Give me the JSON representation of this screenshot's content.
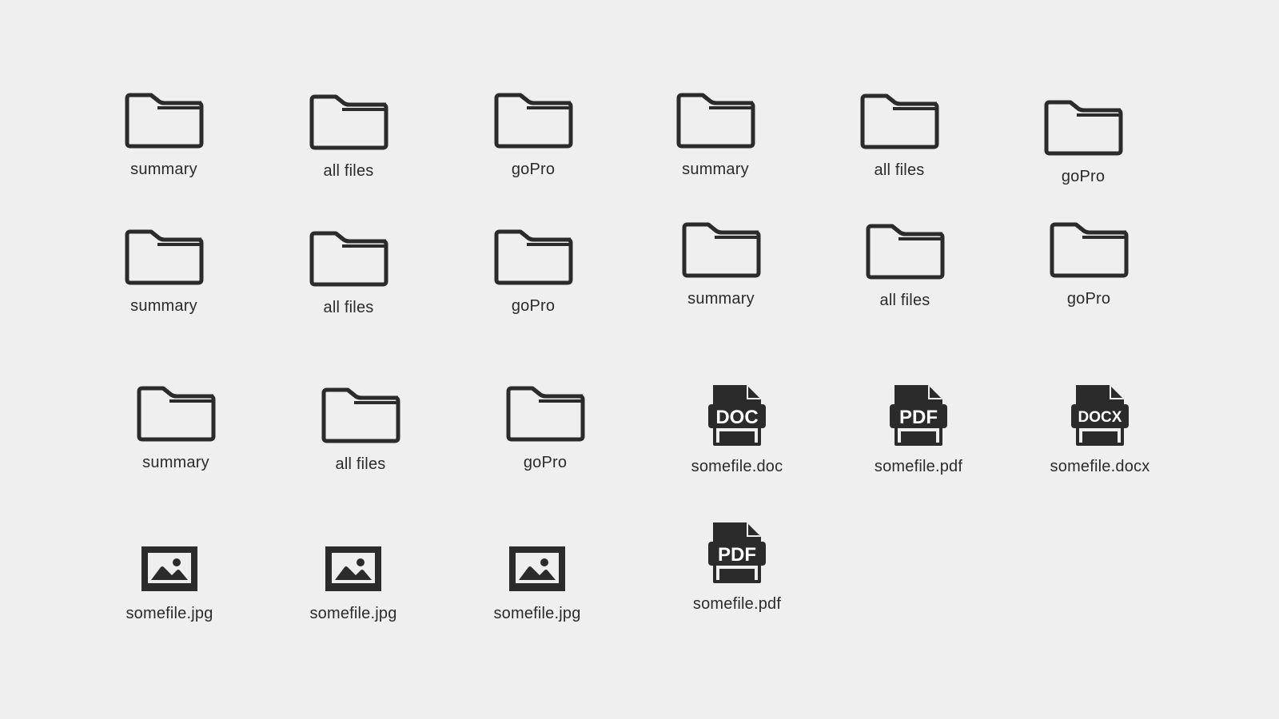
{
  "items": [
    {
      "label": "summary",
      "icon": "folder-icon",
      "type": "folder"
    },
    {
      "label": "all files",
      "icon": "folder-icon",
      "type": "folder"
    },
    {
      "label": "goPro",
      "icon": "folder-icon",
      "type": "folder"
    },
    {
      "label": "summary",
      "icon": "folder-icon",
      "type": "folder"
    },
    {
      "label": "all files",
      "icon": "folder-icon",
      "type": "folder"
    },
    {
      "label": "goPro",
      "icon": "folder-icon",
      "type": "folder"
    },
    {
      "label": "summary",
      "icon": "folder-icon",
      "type": "folder"
    },
    {
      "label": "all files",
      "icon": "folder-icon",
      "type": "folder"
    },
    {
      "label": "goPro",
      "icon": "folder-icon",
      "type": "folder"
    },
    {
      "label": "summary",
      "icon": "folder-icon",
      "type": "folder"
    },
    {
      "label": "all files",
      "icon": "folder-icon",
      "type": "folder"
    },
    {
      "label": "goPro",
      "icon": "folder-icon",
      "type": "folder"
    },
    {
      "label": "summary",
      "icon": "folder-icon",
      "type": "folder"
    },
    {
      "label": "all files",
      "icon": "folder-icon",
      "type": "folder"
    },
    {
      "label": "goPro",
      "icon": "folder-icon",
      "type": "folder"
    },
    {
      "label": "somefile.doc",
      "icon": "doc-file-icon",
      "type": "document",
      "badge": "DOC"
    },
    {
      "label": "somefile.pdf",
      "icon": "pdf-file-icon",
      "type": "document",
      "badge": "PDF"
    },
    {
      "label": "somefile.docx",
      "icon": "docx-file-icon",
      "type": "document",
      "badge": "DOCX"
    },
    {
      "label": "somefile.jpg",
      "icon": "image-file-icon",
      "type": "image"
    },
    {
      "label": "somefile.jpg",
      "icon": "image-file-icon",
      "type": "image"
    },
    {
      "label": "somefile.jpg",
      "icon": "image-file-icon",
      "type": "image"
    },
    {
      "label": "somefile.pdf",
      "icon": "pdf-file-icon",
      "type": "document",
      "badge": "PDF"
    }
  ],
  "colors": {
    "background": "#efefef",
    "icon": "#2b2b2b",
    "text": "#2b2b2b"
  }
}
